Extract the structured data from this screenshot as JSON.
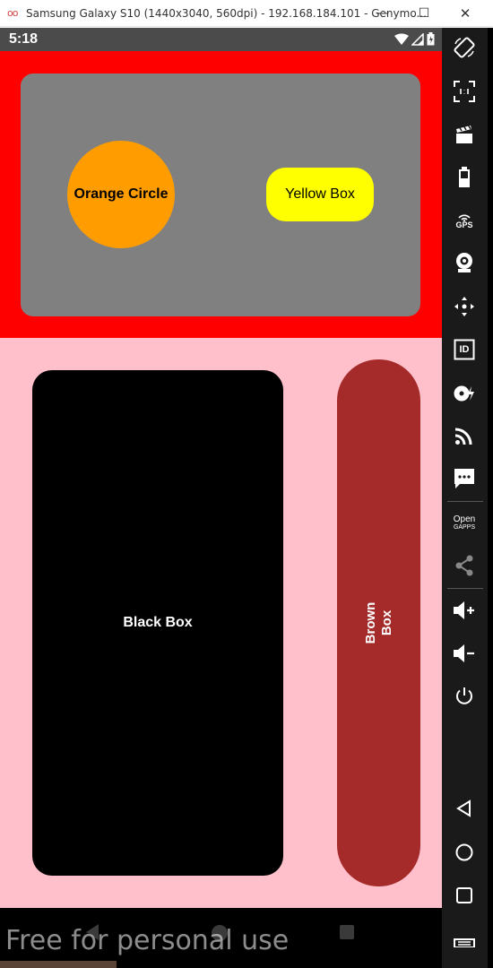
{
  "window": {
    "title": "Samsung Galaxy S10 (1440x3040, 560dpi) - 192.168.184.101 - Genymo...",
    "app_icon": "oo",
    "minimize": "—",
    "maximize": "☐",
    "close": "✕"
  },
  "statusbar": {
    "time": "5:18"
  },
  "app": {
    "orange_label": "Orange Circle",
    "yellow_label": "Yellow Box",
    "black_label": "Black Box",
    "brown_label_line1": "Brown",
    "brown_label_line2": "Box"
  },
  "colors": {
    "red": "#ff0000",
    "grey": "#808080",
    "orange": "#ff9d00",
    "yellow": "#ffff00",
    "pink": "#ffc0cb",
    "black": "#000000",
    "brown": "#a52a2a"
  },
  "toolbar": {
    "gps_label": "GPS",
    "id_label": "ID",
    "opengapps_line1": "Open",
    "opengapps_line2": "GAPPS",
    "icons": [
      "rotate-icon",
      "pixel-perfect-icon",
      "capture-icon",
      "battery-icon",
      "gps-icon",
      "camera-icon",
      "dpad-icon",
      "device-id-icon",
      "disk-io-icon",
      "cast-icon",
      "sms-icon",
      "opengapps-icon",
      "share-icon",
      "volume-up-icon",
      "volume-down-icon",
      "power-icon",
      "back-icon",
      "home-icon",
      "recents-icon",
      "menu-icon"
    ]
  },
  "watermark": "Free for personal use"
}
